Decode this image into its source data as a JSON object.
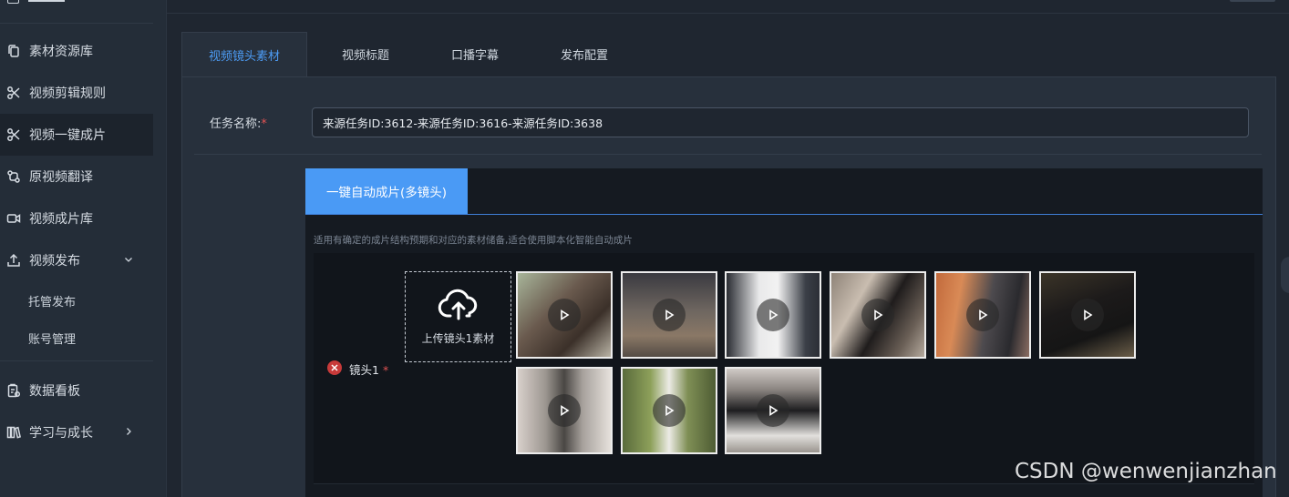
{
  "sidebar": {
    "items": [
      {
        "label": "素材资源库",
        "icon": "copy-icon"
      },
      {
        "label": "视频剪辑规则",
        "icon": "scissors-icon"
      },
      {
        "label": "视频一键成片",
        "icon": "scissors-icon"
      },
      {
        "label": "原视频翻译",
        "icon": "translate-icon"
      },
      {
        "label": "视频成片库",
        "icon": "video-camera-icon"
      },
      {
        "label": "视频发布",
        "icon": "upload-icon"
      },
      {
        "label": "数据看板",
        "icon": "clipboard-icon"
      },
      {
        "label": "学习与成长",
        "icon": "books-icon"
      }
    ],
    "sub_items": [
      "托管发布",
      "账号管理"
    ]
  },
  "tabs": [
    {
      "label": "视频镜头素材"
    },
    {
      "label": "视频标题"
    },
    {
      "label": "口播字幕"
    },
    {
      "label": "发布配置"
    }
  ],
  "form": {
    "task_name_label": "任务名称:",
    "required_mark": "*",
    "task_name_value": "来源任务ID:3612-来源任务ID:3616-来源任务ID:3638"
  },
  "mode": {
    "tab_label": "一键自动成片(多镜头)",
    "description": "适用有确定的成片结构预期和对应的素材储备,适合使用脚本化智能自动成片"
  },
  "shot": {
    "label": "镜头1",
    "upload_label": "上传镜头1素材",
    "thumbnail_count": 9
  },
  "watermark": "CSDN @wenwenjianzhan",
  "colors": {
    "accent": "#4a9af5",
    "danger": "#c83a3a"
  }
}
